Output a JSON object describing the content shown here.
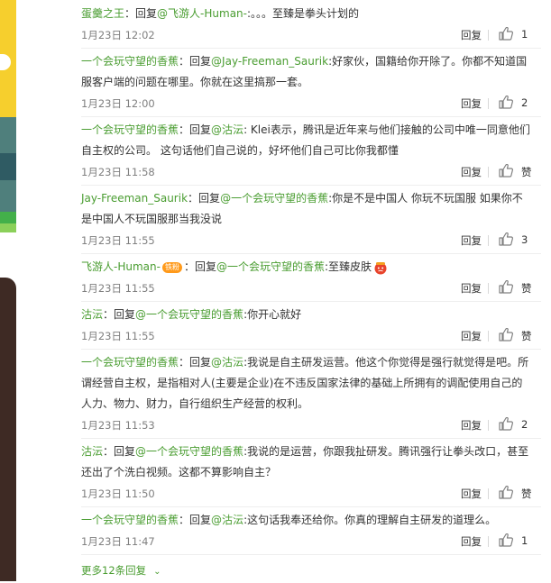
{
  "reply_label": "回复",
  "like_default": "赞",
  "comments": [
    {
      "user": "蛋羹之王",
      "colon": "：",
      "reply_word": "回复",
      "at": "@飞游人-Human-",
      "sep": ":",
      "body": "。。。至臻是拳头计划的",
      "time": "1月23日 12:02",
      "likes": "1"
    },
    {
      "user": "一个会玩守望的香蕉",
      "colon": "：",
      "reply_word": "回复",
      "at": "@Jay-Freeman_Saurik",
      "sep": ":",
      "body": "好家伙，国籍给你开除了。你都不知道国服客户端的问题在哪里。你就在这里搞那一套。",
      "time": "1月23日 12:00",
      "likes": "2"
    },
    {
      "user": "一个会玩守望的香蕉",
      "colon": "：",
      "reply_word": "回复",
      "at": "@沽沄",
      "sep": ":",
      "body": " Klei表示，腾讯是近年来与他们接触的公司中唯一同意他们自主权的公司。 这句话他们自己说的，好坏他们自己可比你我都懂",
      "time": "1月23日 11:58",
      "likes": "赞"
    },
    {
      "user": "Jay-Freeman_Saurik",
      "colon": "：",
      "reply_word": "回复",
      "at": "@一个会玩守望的香蕉",
      "sep": ":",
      "body": "你是不是中国人 你玩不玩国服 如果你不是中国人不玩国服那当我没说",
      "time": "1月23日 11:55",
      "likes": "3"
    },
    {
      "user": "飞游人-Human-",
      "badge": "铁粉",
      "colon": "：",
      "reply_word": "回复",
      "at": "@一个会玩守望的香蕉",
      "sep": ":",
      "body": "至臻皮肤",
      "has_emoji": true,
      "emoji_icon": "angry-face-emoji-icon",
      "time": "1月23日 11:55",
      "likes": "赞"
    },
    {
      "user": "沽沄",
      "colon": "：",
      "reply_word": "回复",
      "at": "@一个会玩守望的香蕉",
      "sep": ":",
      "body": "你开心就好",
      "time": "1月23日 11:55",
      "likes": "赞"
    },
    {
      "user": "一个会玩守望的香蕉",
      "colon": "：",
      "reply_word": "回复",
      "at": "@沽沄",
      "sep": ":",
      "body": "我说是自主研发运营。他这个你觉得是强行就觉得是吧。所谓经营自主权，是指相对人(主要是企业)在不违反国家法律的基础上所拥有的调配使用自己的人力、物力、财力，自行组织生产经营的权利。",
      "time": "1月23日 11:53",
      "likes": "2"
    },
    {
      "user": "沽沄",
      "colon": "：",
      "reply_word": "回复",
      "at": "@一个会玩守望的香蕉",
      "sep": ":",
      "body": "我说的是运营，你跟我扯研发。腾讯强行让拳头改口，甚至还出了个洗白视频。这都不算影响自主？",
      "time": "1月23日 11:50",
      "likes": "赞"
    },
    {
      "user": "一个会玩守望的香蕉",
      "colon": "：",
      "reply_word": "回复",
      "at": "@沽沄",
      "sep": ":",
      "body": "这句话我奉还给你。你真的理解自主研发的道理么。",
      "time": "1月23日 11:47",
      "likes": "1"
    }
  ],
  "more_replies": "更多12条回复",
  "colors": {
    "username": "#4a9d31",
    "text": "#333333",
    "meta": "#808080",
    "badge": "#ff9a1b"
  },
  "icons": {
    "like": "thumbs-up-icon",
    "more": "chevron-down-icon"
  }
}
